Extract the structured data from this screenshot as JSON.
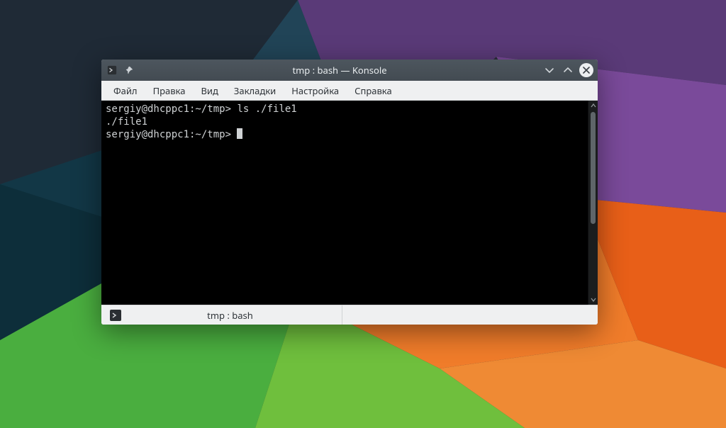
{
  "window": {
    "title": "tmp : bash — Konsole"
  },
  "menubar": {
    "items": [
      "Файл",
      "Правка",
      "Вид",
      "Закладки",
      "Настройка",
      "Справка"
    ]
  },
  "terminal": {
    "lines": [
      {
        "prompt": "sergiy@dhcppc1:~/tmp>",
        "cmd": " ls ./file1"
      },
      {
        "text": "./file1"
      },
      {
        "prompt": "sergiy@dhcppc1:~/tmp>",
        "cursor": true
      }
    ]
  },
  "tabs": [
    {
      "label": "tmp : bash"
    }
  ]
}
